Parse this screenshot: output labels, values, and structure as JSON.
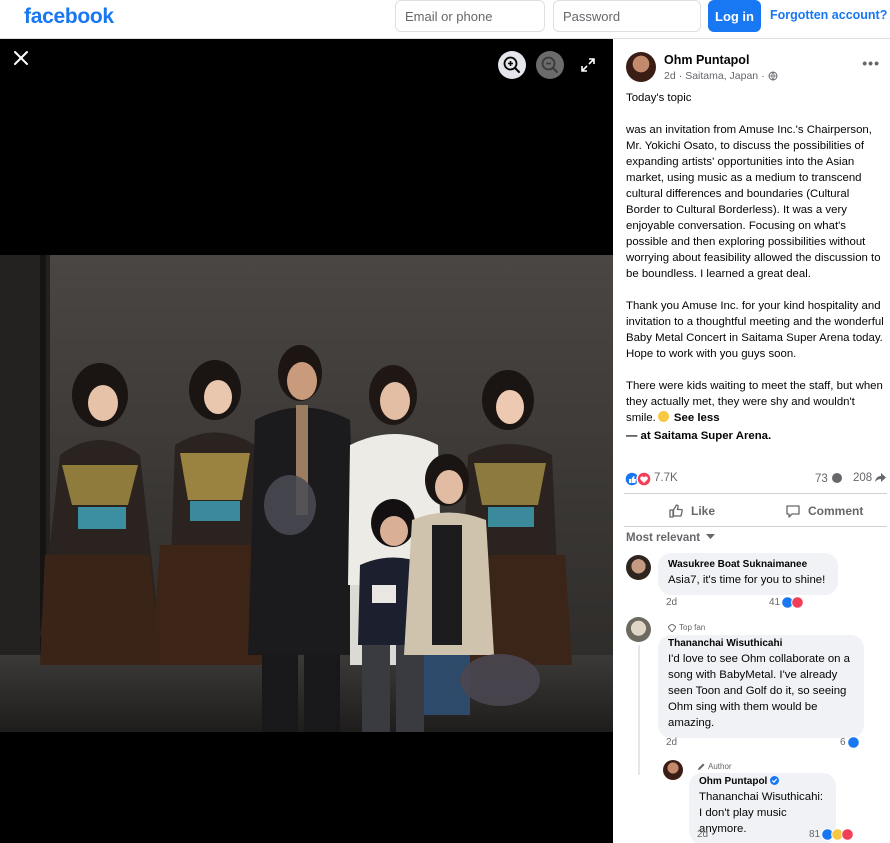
{
  "header": {
    "logo": "facebook",
    "email_placeholder": "Email or phone",
    "password_placeholder": "Password",
    "login_label": "Log in",
    "forgot_label": "Forgotten account?"
  },
  "viewer": {
    "close_icon": "close-icon",
    "zoom_in_icon": "zoom-in-icon",
    "zoom_out_icon": "zoom-out-icon",
    "fullscreen_icon": "fullscreen-icon"
  },
  "post": {
    "author": "Ohm Puntapol",
    "time": "2d",
    "location": "Saitama, Japan",
    "privacy_icon": "globe-icon",
    "paragraphs": [
      "Today's topic",
      "was an invitation from Amuse Inc.'s Chairperson, Mr. Yokichi Osato, to discuss the possibilities of expanding artists' opportunities into the Asian market, using music as a medium to transcend cultural differences and boundaries (Cultural Border to Cultural Borderless). It was a very enjoyable conversation. Focusing on what's possible and then exploring possibilities without worrying about feasibility allowed the discussion to be boundless. I learned a great deal.",
      "Thank you Amuse Inc. for your kind hospitality and invitation to a thoughtful meeting and the wonderful Baby Metal Concert in Saitama Super Arena today. Hope to work with you guys soon."
    ],
    "last_paragraph": "There were kids waiting to meet the staff, but when they actually met, they were shy and wouldn't smile.",
    "see_less": "See less",
    "checkin": "— at Saitama Super Arena.",
    "reactions": "7.7K",
    "comments": "73",
    "shares": "208"
  },
  "actions": {
    "like": "Like",
    "comment": "Comment"
  },
  "sort_label": "Most relevant",
  "comments": [
    {
      "name": "Wasukree Boat Suknaimanee",
      "text": "Asia7, it's time for you to shine!",
      "time": "2d",
      "reactions": "41"
    },
    {
      "badge": "Top fan",
      "name": "Thananchai Wisuthicahi",
      "text": "I'd love to see Ohm collaborate on a song with BabyMetal. I've already seen Toon and Golf do it, so seeing Ohm sing with them would be amazing.",
      "time": "2d",
      "reactions": "6"
    },
    {
      "badge": "Author",
      "name": "Ohm Puntapol",
      "text": "Thananchai Wisuthicahi: I don't play music anymore.",
      "time": "2d",
      "reactions": "81"
    }
  ],
  "colors": {
    "brand": "#1877f2",
    "viewer_bg": "#000000",
    "bubble": "#f0f2f5",
    "muted": "#65676b"
  }
}
